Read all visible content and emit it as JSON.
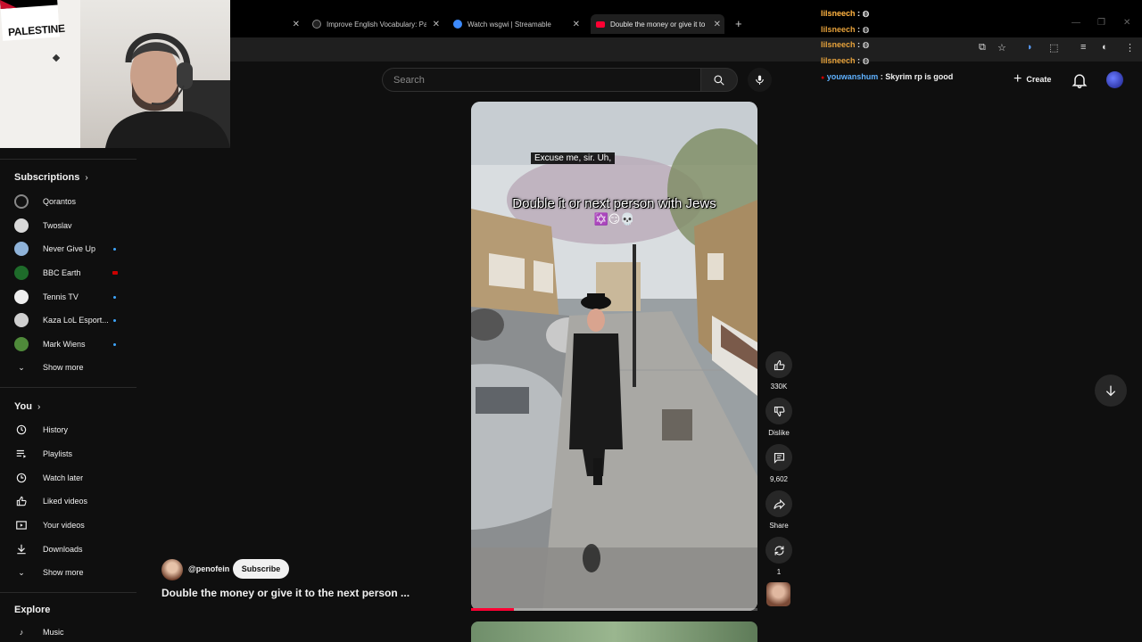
{
  "browser": {
    "tabs": [
      {
        "title": "",
        "icon": "blank"
      },
      {
        "title": "Improve English Vocabulary: Pa",
        "icon": "tiktok-icon"
      },
      {
        "title": "Watch wsgwi | Streamable",
        "icon": "streamable-icon"
      },
      {
        "title": "Double the money or give it to",
        "icon": "youtube-icon"
      }
    ],
    "new_tab_label": "+"
  },
  "header": {
    "search_placeholder": "Search",
    "create_label": "Create"
  },
  "webcam": {
    "flag_text": "PALESTINE"
  },
  "chat": [
    {
      "user": "lilsneech",
      "message": ""
    },
    {
      "user": "lilsneech",
      "message": ""
    },
    {
      "user": "lilsneech",
      "message": ""
    },
    {
      "user": "lilsneech",
      "message": ""
    },
    {
      "user": "lilsneech",
      "message": ""
    },
    {
      "user": "youwanshum",
      "message": "Skyrim rp is good"
    }
  ],
  "sidebar": {
    "subscriptions_title": "Subscriptions",
    "channels": [
      {
        "name": "Qorantos",
        "color": "#2a2a2a",
        "indicator": "none"
      },
      {
        "name": "Twoslav",
        "color": "#d9d9d9",
        "indicator": "none"
      },
      {
        "name": "Never Give Up",
        "color": "#8fb3d9",
        "indicator": "dot"
      },
      {
        "name": "BBC Earth",
        "color": "#1e6b2a",
        "indicator": "live"
      },
      {
        "name": "Tennis TV",
        "color": "#eeeeee",
        "indicator": "dot"
      },
      {
        "name": "Kaza LoL Esport...",
        "color": "#cfcfcf",
        "indicator": "dot"
      },
      {
        "name": "Mark Wiens",
        "color": "#4f8a3a",
        "indicator": "dot"
      }
    ],
    "show_more_1": "Show more",
    "you_title": "You",
    "you_items": [
      {
        "label": "History",
        "icon": "history-icon"
      },
      {
        "label": "Playlists",
        "icon": "playlists-icon"
      },
      {
        "label": "Watch later",
        "icon": "watch-later-icon"
      },
      {
        "label": "Liked videos",
        "icon": "liked-videos-icon"
      },
      {
        "label": "Your videos",
        "icon": "your-videos-icon"
      },
      {
        "label": "Downloads",
        "icon": "downloads-icon"
      }
    ],
    "show_more_2": "Show more",
    "explore_title": "Explore",
    "explore_partial": "Music"
  },
  "short": {
    "caption_top": "Excuse me, sir. Uh,",
    "caption_main": "Double it or next person with Jews",
    "caption_emoji": "✡️😏💀",
    "progress": 0.15,
    "channel_handle": "@penofein",
    "subscribe_label": "Subscribe",
    "title": "Double the money or give it to the next person ..."
  },
  "actions": {
    "like_count": "330K",
    "dislike_label": "Dislike",
    "comment_count": "9,602",
    "share_label": "Share",
    "remix_count": "1"
  },
  "colors": {
    "background": "#0f0f0f",
    "accent_red": "#ff0033",
    "chat_user": "#e7a23b"
  }
}
